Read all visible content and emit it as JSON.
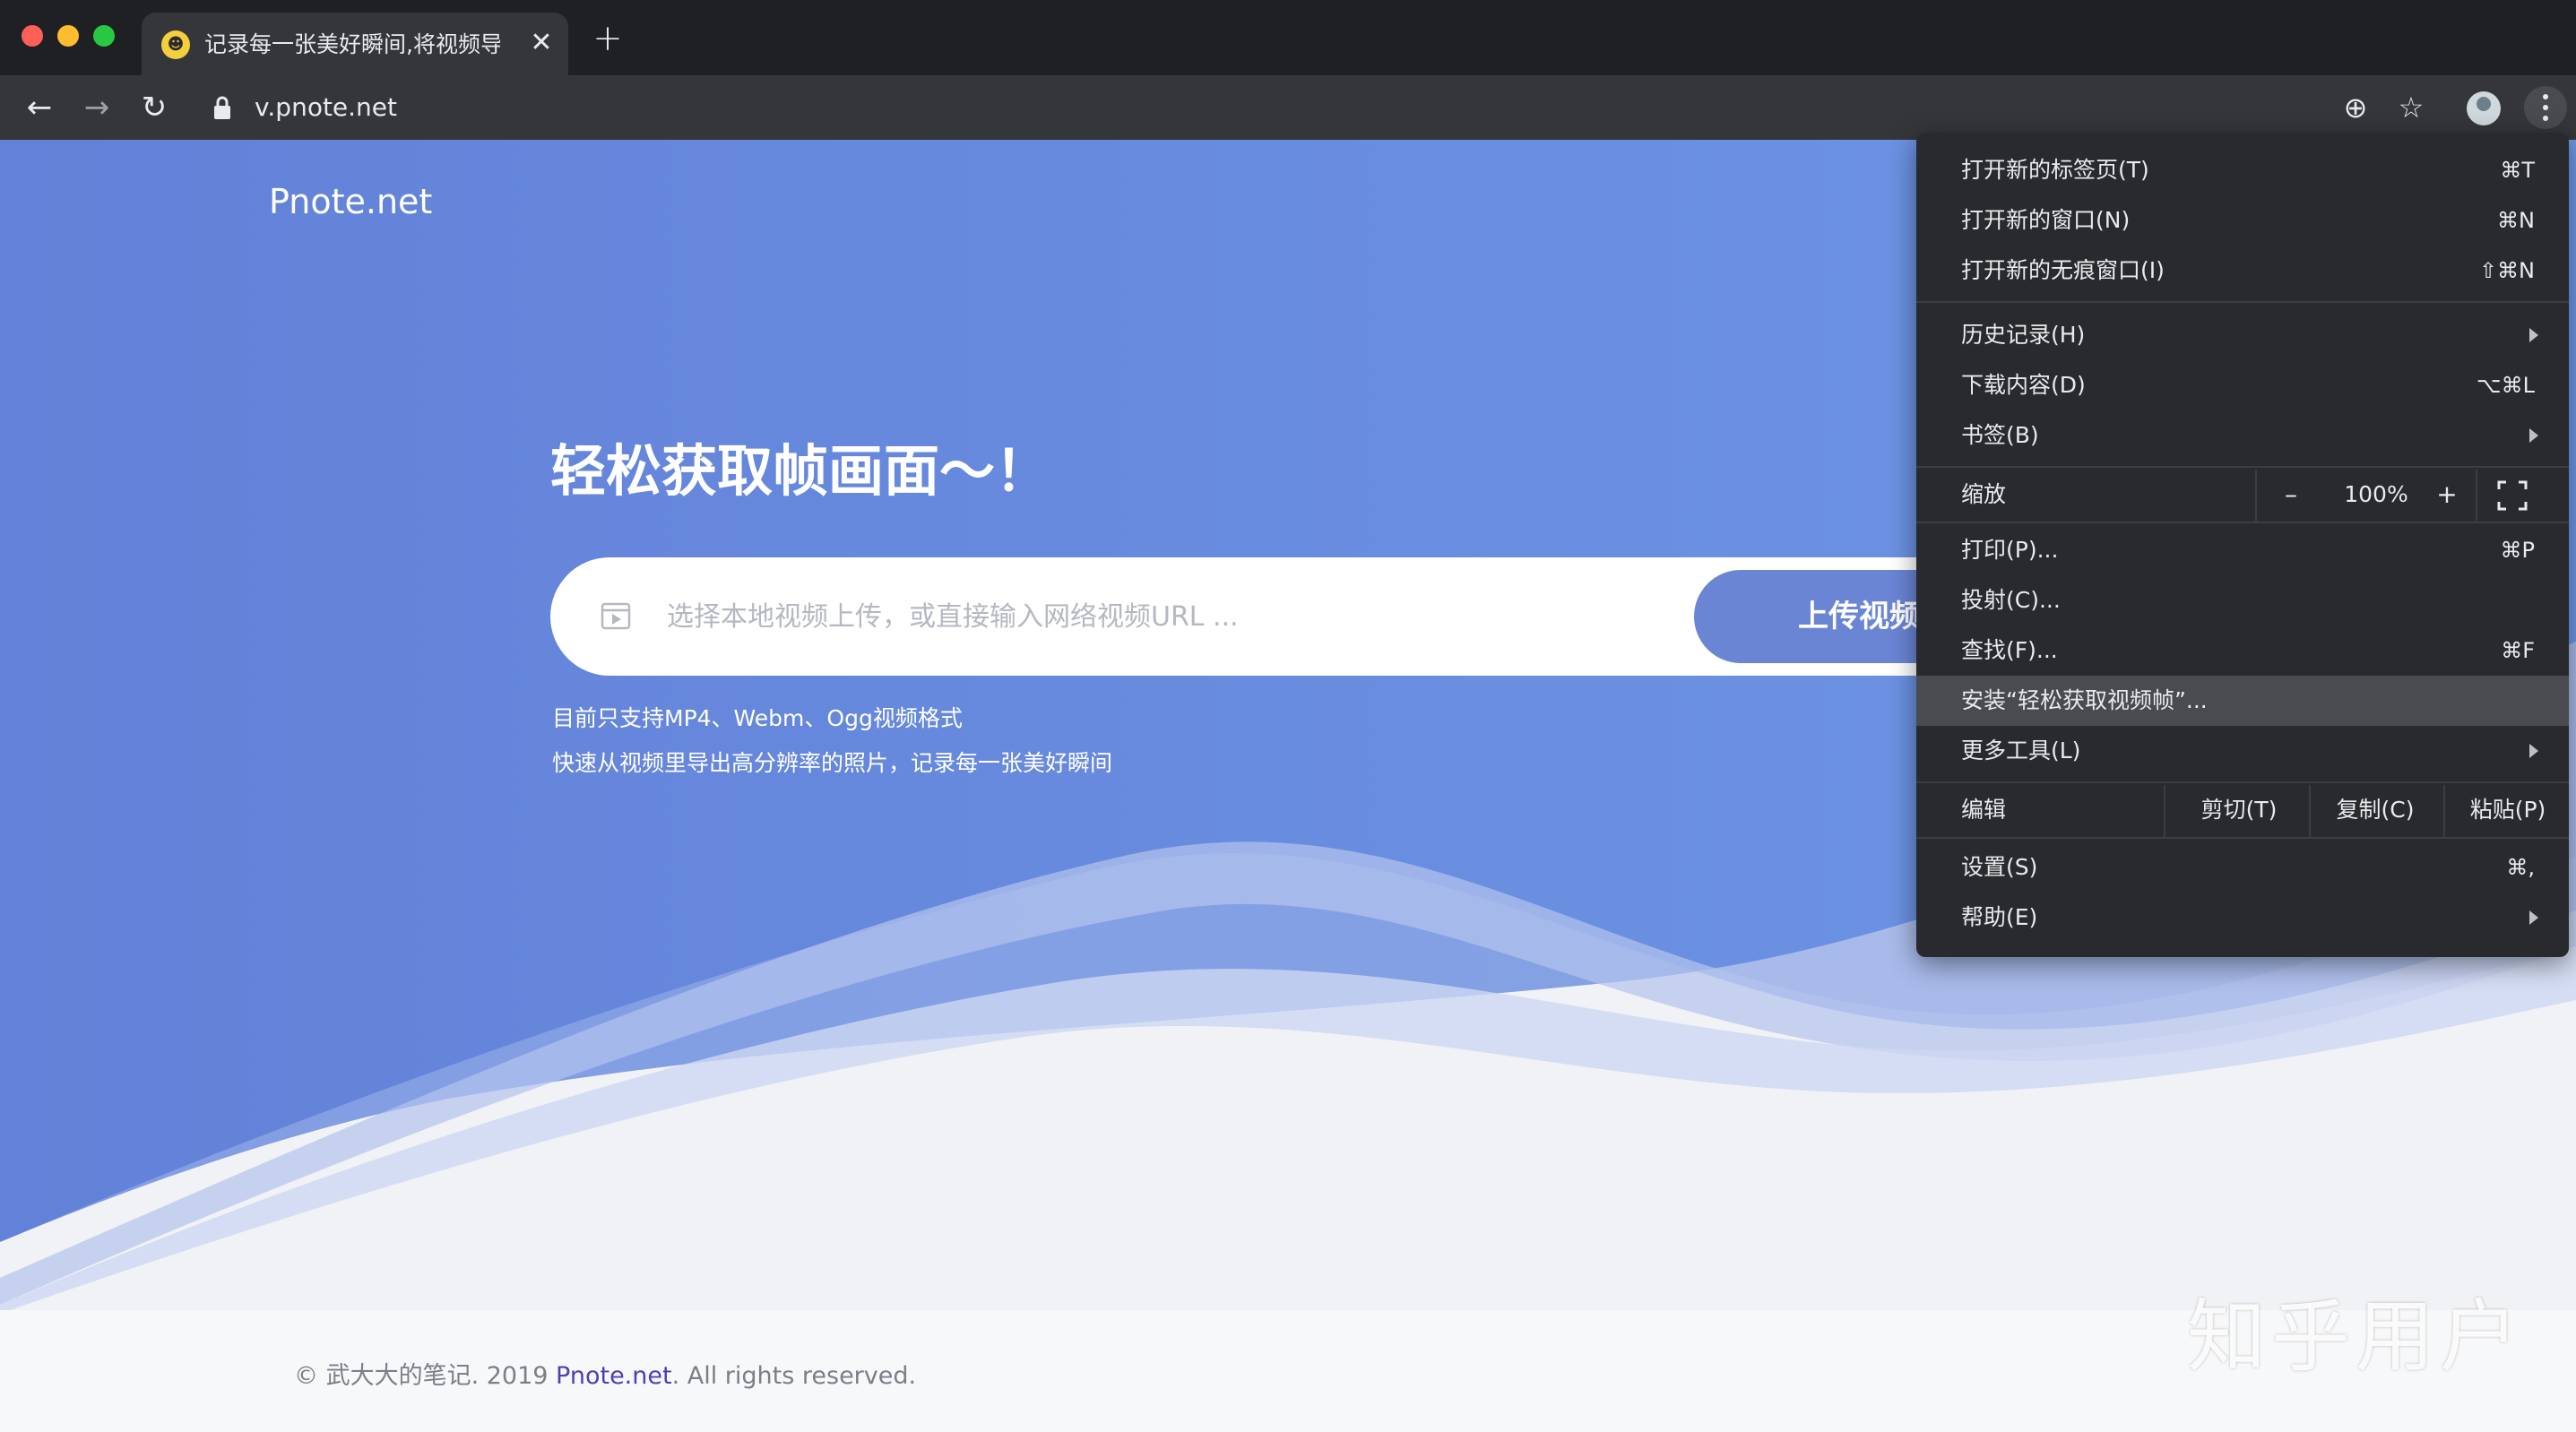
{
  "browser": {
    "tab": {
      "favicon": "pnote-favicon-icon",
      "title": "记录每一张美好瞬间,将视频导出",
      "close_glyph": "✕"
    },
    "new_tab_glyph": "+",
    "nav": {
      "back_glyph": "←",
      "forward_glyph": "→",
      "reload_glyph": "↻"
    },
    "url": "v.pnote.net",
    "toolbar_icons": {
      "install_glyph": "⊕",
      "star_glyph": "☆"
    }
  },
  "page": {
    "brand": "Pnote.net",
    "hero_title": "轻松获取帧画面～！",
    "search": {
      "placeholder": "选择本地视频上传，或直接输入网络视频URL ...",
      "value": ""
    },
    "upload_button": "上传视频",
    "hint_line_1": "目前只支持MP4、Webm、Ogg视频格式",
    "hint_line_2": "快速从视频里导出高分辨率的照片，记录每一张美好瞬间",
    "footer": {
      "prefix": "© 武大大的笔记. 2019 ",
      "link": "Pnote.net",
      "suffix": ". All rights reserved."
    },
    "colors": {
      "hero_blue": "#6b8ee0",
      "link_purple": "#4b3fb8"
    }
  },
  "menu": {
    "new_tab": {
      "label": "打开新的标签页(T)",
      "shortcut": "⌘T"
    },
    "new_window": {
      "label": "打开新的窗口(N)",
      "shortcut": "⌘N"
    },
    "incognito": {
      "label": "打开新的无痕窗口(I)",
      "shortcut": "⇧⌘N"
    },
    "history": {
      "label": "历史记录(H)"
    },
    "downloads": {
      "label": "下载内容(D)",
      "shortcut": "⌥⌘L"
    },
    "bookmarks": {
      "label": "书签(B)"
    },
    "zoom": {
      "label": "缩放",
      "minus": "–",
      "value": "100%",
      "plus": "+"
    },
    "print": {
      "label": "打印(P)...",
      "shortcut": "⌘P"
    },
    "cast": {
      "label": "投射(C)..."
    },
    "find": {
      "label": "查找(F)...",
      "shortcut": "⌘F"
    },
    "install": {
      "label": "安装“轻松获取视频帧”..."
    },
    "more_tools": {
      "label": "更多工具(L)"
    },
    "edit": {
      "label": "编辑",
      "cut": "剪切(T)",
      "copy": "复制(C)",
      "paste": "粘贴(P)"
    },
    "settings": {
      "label": "设置(S)",
      "shortcut": "⌘,"
    },
    "help": {
      "label": "帮助(E)"
    }
  },
  "watermark": "知乎用户"
}
